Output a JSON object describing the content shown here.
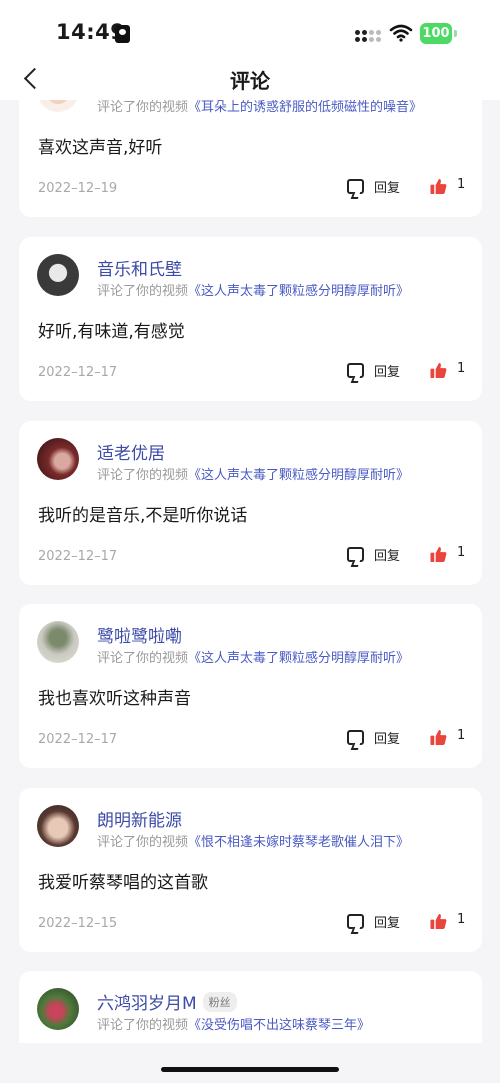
{
  "status_bar": {
    "time": "14:49",
    "battery": "100"
  },
  "header": {
    "title": "评论"
  },
  "partial_card": {
    "subline_prefix": "评论了你的视频",
    "video_title": "《耳朵上的诱惑舒服的低频磁性的噪音》",
    "comment": "喜欢这声音,好听",
    "date": "2022–12–19",
    "reply_label": "回复",
    "likes": "1"
  },
  "cards": [
    {
      "nickname": "音乐和氏壁",
      "subline_prefix": "评论了你的视频",
      "video_title": "《这人声太毒了颗粒感分明醇厚耐听》",
      "comment": "好听,有味道,有感觉",
      "date": "2022–12–17",
      "reply_label": "回复",
      "likes": "1"
    },
    {
      "nickname": "适老优居",
      "subline_prefix": "评论了你的视频",
      "video_title": "《这人声太毒了颗粒感分明醇厚耐听》",
      "comment": "我听的是音乐,不是听你说话",
      "date": "2022–12–17",
      "reply_label": "回复",
      "likes": "1"
    },
    {
      "nickname": "鹭啦鹭啦嘞",
      "subline_prefix": "评论了你的视频",
      "video_title": "《这人声太毒了颗粒感分明醇厚耐听》",
      "comment": "我也喜欢听这种声音",
      "date": "2022–12–17",
      "reply_label": "回复",
      "likes": "1"
    },
    {
      "nickname": "朗明新能源",
      "subline_prefix": "评论了你的视频",
      "video_title": "《恨不相逢未嫁时蔡琴老歌催人泪下》",
      "comment": "我爱听蔡琴唱的这首歌",
      "date": "2022–12–15",
      "reply_label": "回复",
      "likes": "1"
    },
    {
      "nickname": "六鸿羽岁月M",
      "badge": "粉丝",
      "subline_prefix": "评论了你的视频",
      "video_title": "《没受伤唱不出这味蔡琴三年》"
    }
  ],
  "colors": {
    "nickname": "#3c4ba8",
    "video_title": "#4a5bc4",
    "like": "#e8453c",
    "battery": "#4cd964"
  },
  "icons": [
    "back-icon",
    "reply-icon",
    "thumbs-up-icon",
    "signal-icon",
    "wifi-icon",
    "battery-icon",
    "id-card-icon"
  ]
}
